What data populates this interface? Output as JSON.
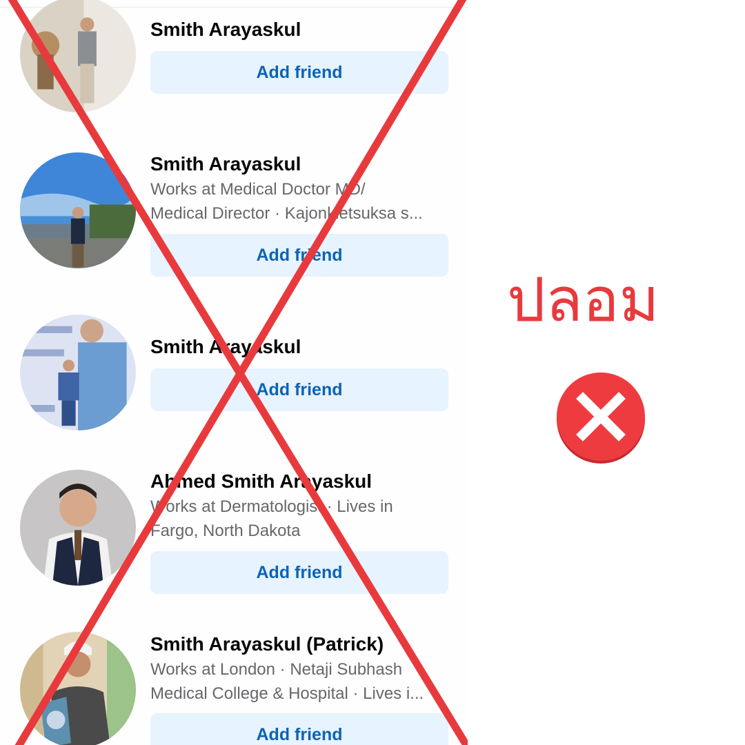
{
  "results": [
    {
      "name": "Smith Arayaskul",
      "details": [],
      "button": "Add friend"
    },
    {
      "name": "Smith Arayaskul",
      "details": [
        "Works at Medical Doctor MD/",
        "Medical Director · Kajonkietsuksa s..."
      ],
      "button": "Add friend"
    },
    {
      "name": "Smith Arayaskul",
      "details": [],
      "button": "Add friend"
    },
    {
      "name": "Ahmed Smith Arayaskul",
      "details": [
        "Works at Dermatologist · Lives in",
        "Fargo, North Dakota"
      ],
      "button": "Add friend"
    },
    {
      "name": "Smith Arayaskul (Patrick)",
      "details": [
        "Works at London · Netaji Subhash",
        "Medical College & Hospital · Lives i..."
      ],
      "button": "Add friend"
    }
  ],
  "verdict": {
    "label": "ปลอม",
    "icon": "x-circle-icon"
  },
  "colors": {
    "warning_red": "#e83a3d",
    "button_bg": "#e7f3ff",
    "button_text": "#0b64b5",
    "secondary_text": "#65676b"
  }
}
